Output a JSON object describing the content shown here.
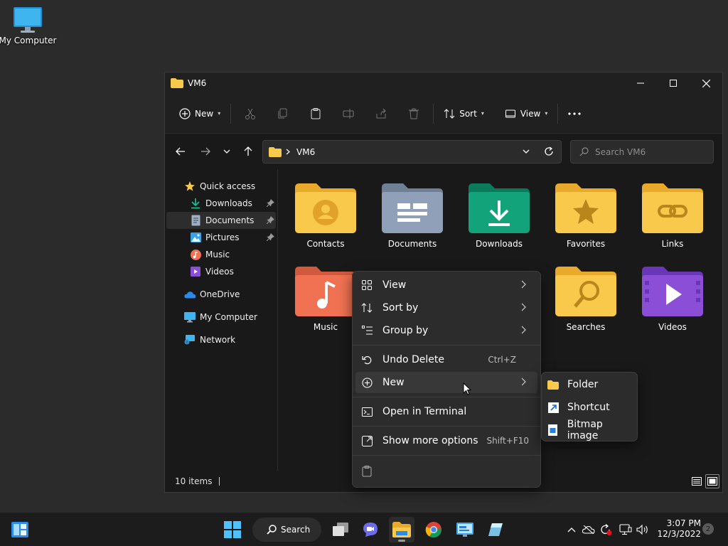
{
  "desktop": {
    "icon_label": "My Computer"
  },
  "window": {
    "title": "VM6",
    "toolbar": {
      "new_label": "New",
      "sort_label": "Sort",
      "view_label": "View"
    },
    "address": {
      "path": "VM6"
    },
    "search": {
      "placeholder": "Search VM6"
    },
    "sidebar": [
      {
        "label": "Quick access",
        "icon": "star-icon"
      },
      {
        "label": "Downloads",
        "icon": "download-icon",
        "pinned": true
      },
      {
        "label": "Documents",
        "icon": "document-icon",
        "pinned": true,
        "selected": true
      },
      {
        "label": "Pictures",
        "icon": "pictures-icon",
        "pinned": true
      },
      {
        "label": "Music",
        "icon": "music-icon"
      },
      {
        "label": "Videos",
        "icon": "videos-icon"
      },
      {
        "label": "OneDrive",
        "icon": "cloud-icon"
      },
      {
        "label": "My Computer",
        "icon": "monitor-icon"
      },
      {
        "label": "Network",
        "icon": "network-icon"
      }
    ],
    "folders": [
      {
        "label": "Contacts",
        "icon": "contacts-folder-icon"
      },
      {
        "label": "Documents",
        "icon": "documents-folder-icon"
      },
      {
        "label": "Downloads",
        "icon": "downloads-folder-icon"
      },
      {
        "label": "Favorites",
        "icon": "favorites-folder-icon"
      },
      {
        "label": "Links",
        "icon": "links-folder-icon"
      },
      {
        "label": "Music",
        "icon": "music-folder-icon"
      },
      {
        "label": "Searches",
        "icon": "searches-folder-icon"
      },
      {
        "label": "Videos",
        "icon": "videos-folder-icon"
      }
    ],
    "status": {
      "items_count": "10 items"
    }
  },
  "context_menu": {
    "items": [
      {
        "label": "View",
        "icon": "grid-icon",
        "submenu": true
      },
      {
        "label": "Sort by",
        "icon": "sort-icon",
        "submenu": true
      },
      {
        "label": "Group by",
        "icon": "group-icon",
        "submenu": true
      },
      {
        "label": "Undo Delete",
        "icon": "undo-icon",
        "shortcut": "Ctrl+Z"
      },
      {
        "label": "New",
        "icon": "plus-circle-icon",
        "submenu": true,
        "hovered": true
      },
      {
        "label": "Open in Terminal",
        "icon": "terminal-icon"
      },
      {
        "label": "Show more options",
        "icon": "more-options-icon",
        "shortcut": "Shift+F10"
      }
    ],
    "new_submenu": [
      {
        "label": "Folder",
        "icon": "folder-icon"
      },
      {
        "label": "Shortcut",
        "icon": "shortcut-icon"
      },
      {
        "label": "Bitmap image",
        "icon": "bitmap-icon"
      }
    ]
  },
  "taskbar": {
    "search_label": "Search",
    "clock": {
      "time": "3:07 PM",
      "date": "12/3/2022"
    },
    "notification_count": "2"
  },
  "colors": {
    "folder_yellow": "#f8c94a",
    "folder_green": "#12a37a",
    "folder_blue_gray": "#8fa0b8",
    "folder_music": "#f07252",
    "folder_video": "#8a4fd6",
    "accent_blue": "#4cc2ff"
  }
}
